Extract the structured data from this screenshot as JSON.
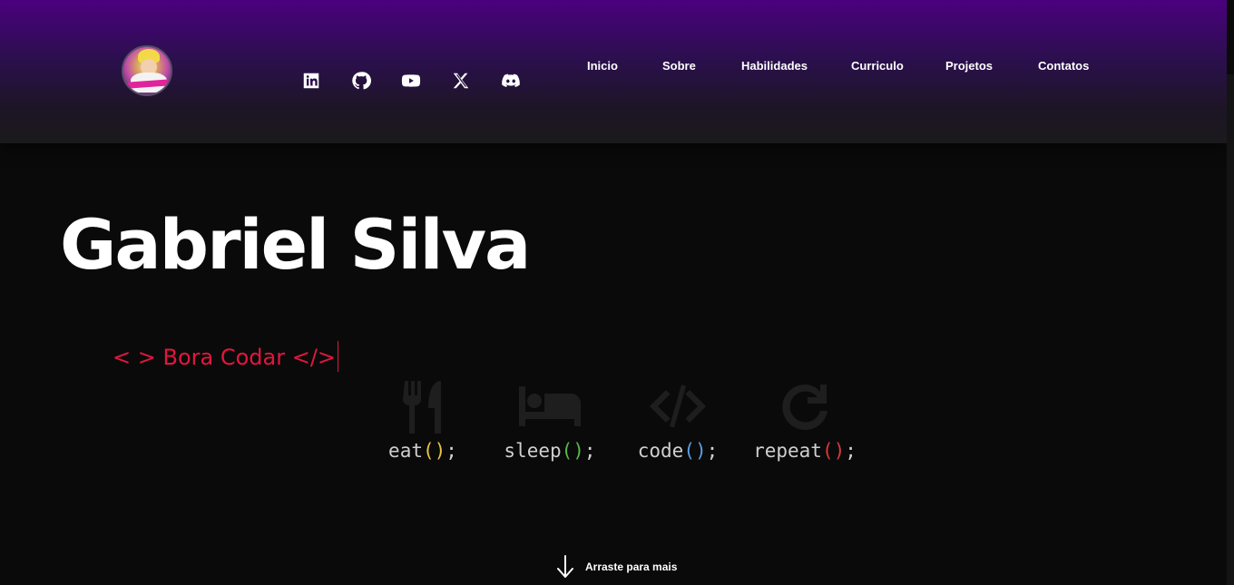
{
  "logo": {
    "alt": "Bonquixote"
  },
  "social": [
    {
      "name": "linkedin",
      "icon": "linkedin-icon"
    },
    {
      "name": "github",
      "icon": "github-icon"
    },
    {
      "name": "youtube",
      "icon": "youtube-icon"
    },
    {
      "name": "x",
      "icon": "x-icon"
    },
    {
      "name": "discord",
      "icon": "discord-icon"
    }
  ],
  "nav": [
    {
      "label": "Inicio"
    },
    {
      "label": "Sobre"
    },
    {
      "label": "Habilidades"
    },
    {
      "label": "Curriculo"
    },
    {
      "label": "Projetos"
    },
    {
      "label": "Contatos"
    }
  ],
  "hero": {
    "name": "Gabriel Silva",
    "typed": "< > Bora Codar </>"
  },
  "loop": [
    {
      "fn": "eat",
      "icon": "utensils-icon",
      "paren_color": "#e8c547"
    },
    {
      "fn": "sleep",
      "icon": "bed-icon",
      "paren_color": "#59b849"
    },
    {
      "fn": "code",
      "icon": "code-icon",
      "paren_color": "#5c9fe0"
    },
    {
      "fn": "repeat",
      "icon": "redo-icon",
      "paren_color": "#d63a3a"
    }
  ],
  "scroll_hint": {
    "label": "Arraste para mais",
    "icon": "arrow-down-icon"
  },
  "colors": {
    "accent_purple": "#4b007f",
    "typed_red": "#e3163f",
    "background": "#0a0a0a"
  }
}
